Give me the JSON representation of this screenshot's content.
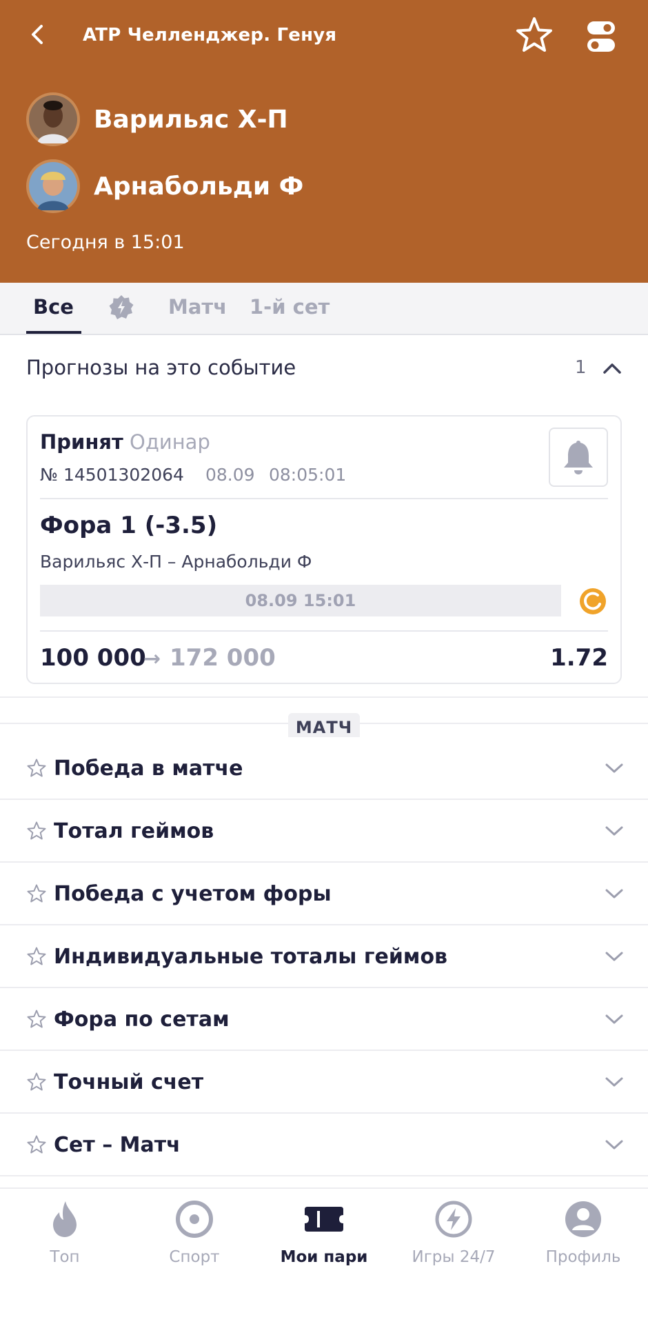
{
  "header": {
    "title": "ATP Челленджер. Генуя",
    "players": [
      {
        "name": "Варильяс Х-П"
      },
      {
        "name": "Арнабольди Ф"
      }
    ],
    "date_time": "Сегодня в 15:01",
    "background_color": "#b1622a"
  },
  "tabs": [
    {
      "label": "Все",
      "active": true
    },
    {
      "label": "",
      "icon": "badge-icon"
    },
    {
      "label": "Матч"
    },
    {
      "label": "1-й сет"
    }
  ],
  "forecast": {
    "title": "Прогнозы на это событие",
    "count": "1"
  },
  "bet": {
    "status": "Принят",
    "kind": "Одинар",
    "number": "№ 14501302064",
    "date": "08.09",
    "time": "08:05:01",
    "market": "Фора 1 (-3.5)",
    "event": "Варильяс Х-П – Арнабольди Ф",
    "event_date": "08.09 15:01",
    "stake": "100 000",
    "arrow": "→",
    "payout": "172 000",
    "odds": "1.72"
  },
  "section_label": "МАТЧ",
  "markets": [
    {
      "label": "Победа в матче"
    },
    {
      "label": "Тотал геймов"
    },
    {
      "label": "Победа с учетом форы"
    },
    {
      "label": "Индивидуальные тоталы геймов"
    },
    {
      "label": "Фора по сетам"
    },
    {
      "label": "Точный счет"
    },
    {
      "label": "Сет – Матч"
    }
  ],
  "bottom_nav": [
    {
      "label": "Топ",
      "icon": "flame-icon"
    },
    {
      "label": "Спорт",
      "icon": "target-icon"
    },
    {
      "label": "Мои пари",
      "icon": "ticket-icon",
      "active": true
    },
    {
      "label": "Игры 24/7",
      "icon": "lightning-icon"
    },
    {
      "label": "Профиль",
      "icon": "profile-icon"
    }
  ]
}
